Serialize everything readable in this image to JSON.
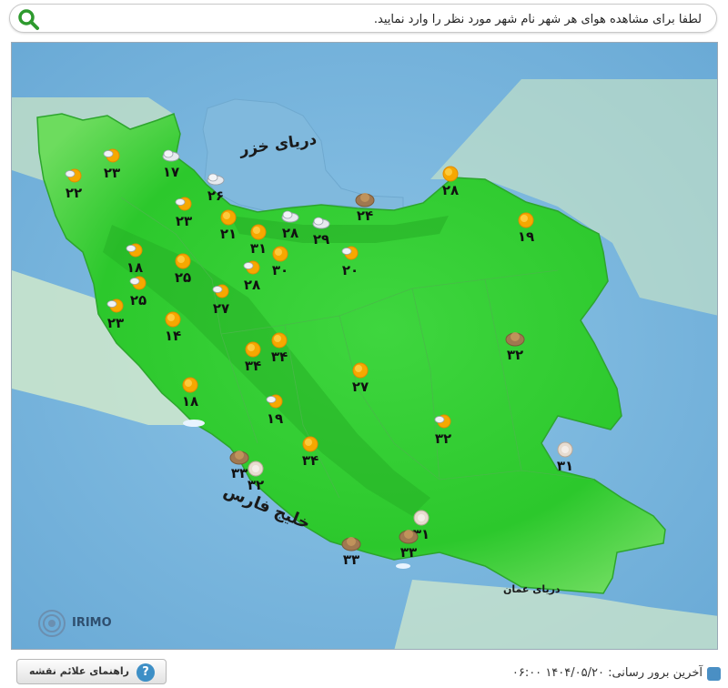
{
  "search": {
    "placeholder": "لطفا برای مشاهده هوای هر شهر نام شهر مورد نظر را وارد نمایید.",
    "icon": "search-icon"
  },
  "map": {
    "seas": {
      "caspian": "دریای خزر",
      "persian_gulf": "خلیج فارس",
      "oman": "دریای عمان"
    },
    "logo": "IRIMO",
    "colors": {
      "land": "#3ccf3c",
      "water": "#7fb8dd",
      "sun": "#f4a300"
    },
    "cities": [
      {
        "temp": "۲۲",
        "icon": "sun-cloud-icon"
      },
      {
        "temp": "۲۳",
        "icon": "sun-cloud-icon"
      },
      {
        "temp": "۱۷",
        "icon": "cloud-icon"
      },
      {
        "temp": "۲۶",
        "icon": "cloud-icon"
      },
      {
        "temp": "۲۳",
        "icon": "sun-cloud-icon"
      },
      {
        "temp": "۲۱",
        "icon": "sun-icon"
      },
      {
        "temp": "۳۱",
        "icon": "sun-icon"
      },
      {
        "temp": "۲۸",
        "icon": "cloud-icon"
      },
      {
        "temp": "۲۹",
        "icon": "cloud-icon"
      },
      {
        "temp": "۲۴",
        "icon": "dust-icon"
      },
      {
        "temp": "۲۸",
        "icon": "sun-icon"
      },
      {
        "temp": "۱۹",
        "icon": "sun-icon"
      },
      {
        "temp": "۱۸",
        "icon": "sun-cloud-icon"
      },
      {
        "temp": "۲۵",
        "icon": "sun-icon"
      },
      {
        "temp": "۲۸",
        "icon": "sun-cloud-icon"
      },
      {
        "temp": "۳۰",
        "icon": "sun-icon"
      },
      {
        "temp": "۲۰",
        "icon": "sun-cloud-icon"
      },
      {
        "temp": "۲۵",
        "icon": "sun-cloud-icon"
      },
      {
        "temp": "۲۷",
        "icon": "sun-cloud-icon"
      },
      {
        "temp": "۲۳",
        "icon": "sun-cloud-icon"
      },
      {
        "temp": "۱۴",
        "icon": "sun-icon"
      },
      {
        "temp": "۳۴",
        "icon": "sun-icon"
      },
      {
        "temp": "۳۴",
        "icon": "sun-icon"
      },
      {
        "temp": "۲۷",
        "icon": "sun-icon"
      },
      {
        "temp": "۳۲",
        "icon": "dust-icon"
      },
      {
        "temp": "۱۸",
        "icon": "sun-icon"
      },
      {
        "temp": "۱۹",
        "icon": "sun-cloud-icon"
      },
      {
        "temp": "۳۲",
        "icon": "sun-cloud-icon"
      },
      {
        "temp": "۳۴",
        "icon": "sun-icon"
      },
      {
        "temp": "۳۱",
        "icon": "haze-icon"
      },
      {
        "temp": "۳۳",
        "icon": "dust-icon"
      },
      {
        "temp": "۳۲",
        "icon": "haze-icon"
      },
      {
        "temp": "۳۱",
        "icon": "haze-icon"
      },
      {
        "temp": "۳۳",
        "icon": "dust-icon"
      },
      {
        "temp": "۳۳",
        "icon": "dust-icon"
      }
    ]
  },
  "footer": {
    "legend_button": "راهنمای علائم نقشه",
    "help_glyph": "?",
    "update_label": "آخرین برور رسانی:",
    "update_value": "۱۴۰۴/۰۵/۲۰ ۰۶:۰۰"
  }
}
